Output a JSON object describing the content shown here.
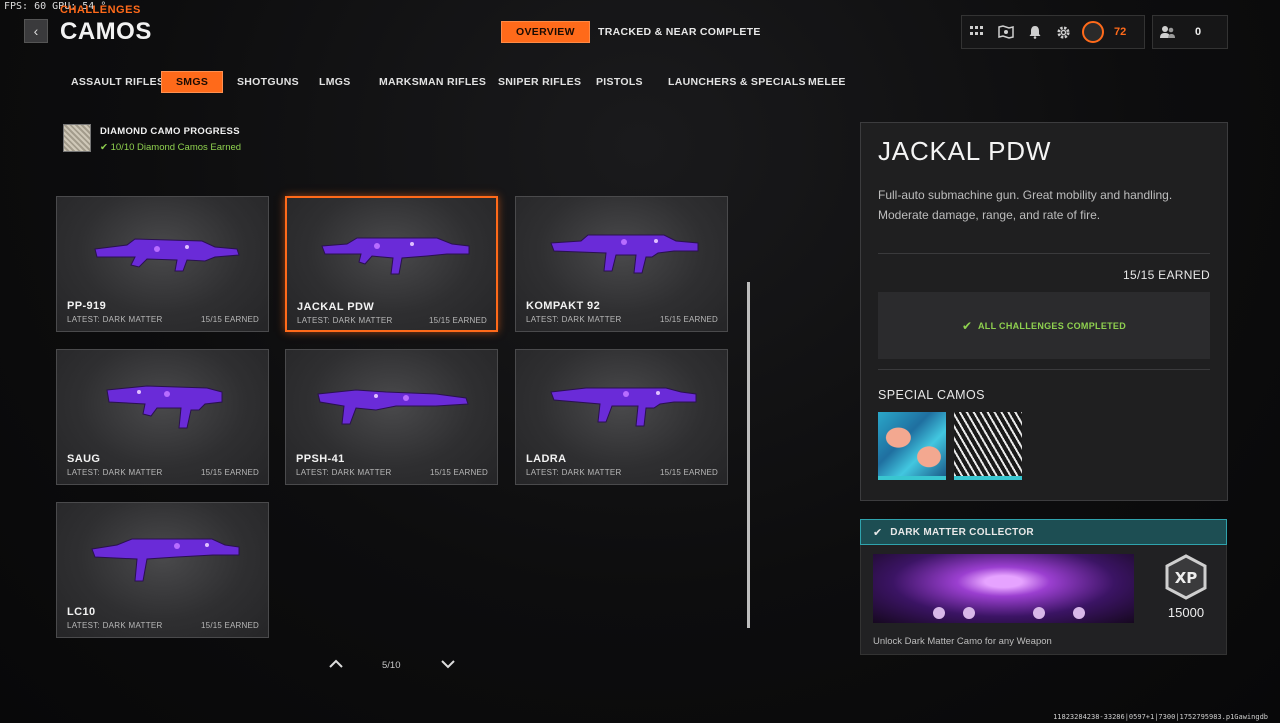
{
  "overlay": {
    "fps": "FPS:  60  GPU: 54  °"
  },
  "header": {
    "breadcrumb": "CHALLENGES",
    "title": "CAMOS",
    "tabs": [
      {
        "label": "OVERVIEW",
        "active": true
      },
      {
        "label": "TRACKED & NEAR COMPLETE",
        "active": false
      }
    ],
    "hud": {
      "icons": [
        "grid-icon",
        "map-icon",
        "bell-icon",
        "gear-icon"
      ],
      "rank": "72",
      "friends": "0"
    }
  },
  "categories": [
    {
      "label": "ASSAULT RIFLES",
      "active": false
    },
    {
      "label": "SMGS",
      "active": true
    },
    {
      "label": "SHOTGUNS",
      "active": false
    },
    {
      "label": "LMGS",
      "active": false
    },
    {
      "label": "MARKSMAN RIFLES",
      "active": false
    },
    {
      "label": "SNIPER RIFLES",
      "active": false
    },
    {
      "label": "PISTOLS",
      "active": false
    },
    {
      "label": "LAUNCHERS & SPECIALS",
      "active": false
    },
    {
      "label": "MELEE",
      "active": false
    }
  ],
  "diamond": {
    "title": "DIAMOND CAMO PROGRESS",
    "subtitle": "10/10 Diamond Camos Earned"
  },
  "weapons": [
    {
      "name": "PP-919",
      "latest": "LATEST: DARK MATTER",
      "earned": "15/15 EARNED",
      "selected": false
    },
    {
      "name": "JACKAL PDW",
      "latest": "LATEST: DARK MATTER",
      "earned": "15/15 EARNED",
      "selected": true
    },
    {
      "name": "KOMPAKT 92",
      "latest": "LATEST: DARK MATTER",
      "earned": "15/15 EARNED",
      "selected": false
    },
    {
      "name": "SAUG",
      "latest": "LATEST: DARK MATTER",
      "earned": "15/15 EARNED",
      "selected": false
    },
    {
      "name": "PPSH-41",
      "latest": "LATEST: DARK MATTER",
      "earned": "15/15 EARNED",
      "selected": false
    },
    {
      "name": "LADRA",
      "latest": "LATEST: DARK MATTER",
      "earned": "15/15 EARNED",
      "selected": false
    },
    {
      "name": "LC10",
      "latest": "LATEST: DARK MATTER",
      "earned": "15/15 EARNED",
      "selected": false
    }
  ],
  "pager": {
    "label": "5/10"
  },
  "details": {
    "name": "JACKAL PDW",
    "description": "Full-auto submachine gun.  Great mobility and handling. Moderate damage, range, and rate of fire.",
    "earned": "15/15 EARNED",
    "challenges_status": "ALL CHALLENGES COMPLETED",
    "special_title": "SPECIAL CAMOS"
  },
  "reward": {
    "title": "DARK MATTER COLLECTOR",
    "xp": "15000",
    "xp_badge": "XP",
    "description": "Unlock Dark Matter Camo for any Weapon"
  },
  "footer": {
    "code": "11823284238-33286|0597+1|7300|1752795983.p1Gawingdb"
  },
  "colors": {
    "accent": "#ff6a1a",
    "success": "#8fd14f",
    "teal": "#2fa3ad",
    "camo_purple": "#6a2bd8"
  }
}
